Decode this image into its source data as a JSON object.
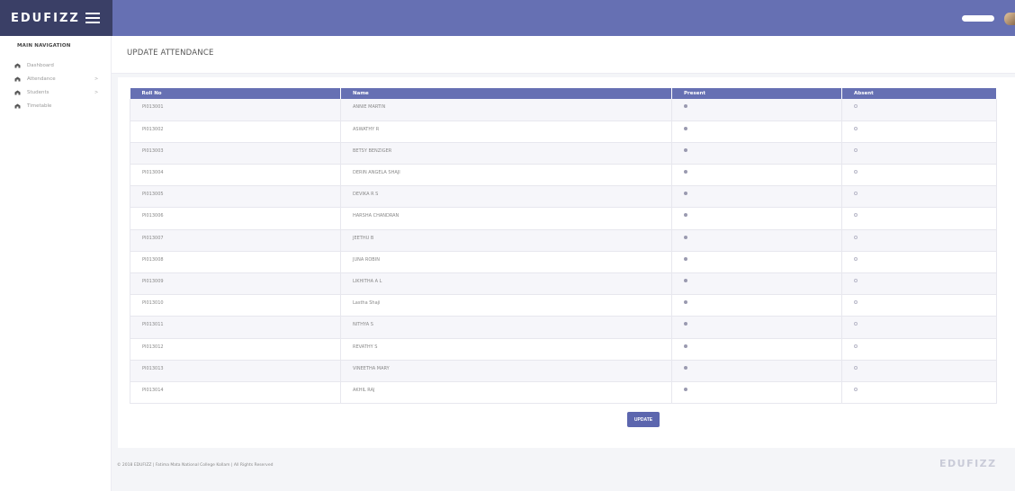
{
  "app": {
    "brand": "EDUFIZZ"
  },
  "sidebar": {
    "heading": "MAIN NAVIGATION",
    "items": [
      {
        "label": "Dashboard",
        "icon": "dashboard-icon",
        "has_submenu": false
      },
      {
        "label": "Attendance",
        "icon": "dashboard-icon",
        "has_submenu": true
      },
      {
        "label": "Students",
        "icon": "dashboard-icon",
        "has_submenu": true
      },
      {
        "label": "Timetable",
        "icon": "dashboard-icon",
        "has_submenu": false
      }
    ],
    "chevron": ">"
  },
  "page": {
    "title": "UPDATE ATTENDANCE"
  },
  "table": {
    "columns": [
      "Roll No",
      "Name",
      "Present",
      "Absent"
    ],
    "rows": [
      {
        "roll": "PI013001",
        "name": "ANNIE MARTIN",
        "present": true
      },
      {
        "roll": "PI013002",
        "name": "ASWATHY R",
        "present": true
      },
      {
        "roll": "PI013003",
        "name": "BETSY BENZIGER",
        "present": true
      },
      {
        "roll": "PI013004",
        "name": "DERIN ANGELA SHAJI",
        "present": true
      },
      {
        "roll": "PI013005",
        "name": "DEVIKA R S",
        "present": true
      },
      {
        "roll": "PI013006",
        "name": "HARSHA CHANDRAN",
        "present": true
      },
      {
        "roll": "PI013007",
        "name": "JEETHU B",
        "present": true
      },
      {
        "roll": "PI013008",
        "name": "JUNA ROBIN",
        "present": true
      },
      {
        "roll": "PI013009",
        "name": "LIKHITHA A L",
        "present": true
      },
      {
        "roll": "PI013010",
        "name": "Lastha Shaji",
        "present": true
      },
      {
        "roll": "PI013011",
        "name": "NITHYA S",
        "present": true
      },
      {
        "roll": "PI013012",
        "name": "REVATHY S",
        "present": true
      },
      {
        "roll": "PI013013",
        "name": "VINEETHA MARY",
        "present": true
      },
      {
        "roll": "PI013014",
        "name": "AKHIL RAJ",
        "present": true
      }
    ]
  },
  "actions": {
    "update_label": "UPDATE"
  },
  "footer": {
    "copyright": "© 2018 EDUFIZZ | Fatima Mata National College Kollam | All Rights Reserved",
    "logo_text": "EDUFIZZ"
  },
  "colors": {
    "topbar": "#6670b3",
    "brand_bg": "#3a3f66",
    "button": "#5c66ae"
  }
}
